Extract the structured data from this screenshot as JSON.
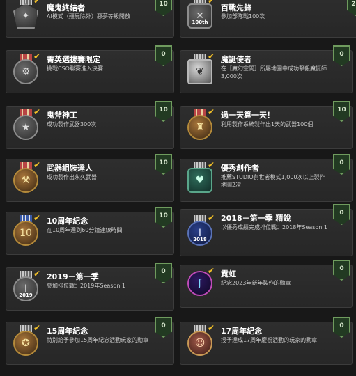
{
  "achievements": [
    {
      "title": "魔鬼終結者",
      "desc": "AI模式（殭屍除外）惡夢等級開啟",
      "points": "10",
      "icon": "shield-emblem-icon"
    },
    {
      "title": "百戰先鋒",
      "desc": "參加部隊戰100次",
      "points": "20",
      "icon": "crossed-rifles-100-icon",
      "medal_text": "100th"
    },
    {
      "title": "菁英選拔賽限定",
      "desc": "挑戰CSO聯賽進入決賽",
      "points": "0",
      "icon": "gear-medal-icon"
    },
    {
      "title": "魔誕使者",
      "desc": "在［魔幻空間］所屬地圖中成功擊殺魔誕師3,000次",
      "points": "0",
      "icon": "eagle-emblem-icon"
    },
    {
      "title": "鬼斧神工",
      "desc": "成功製作武器300次",
      "points": "10",
      "icon": "star-medal-icon"
    },
    {
      "title": "過一天算一天！",
      "desc": "利用製作系統製作出1天的武器100個",
      "points": "10",
      "icon": "backpack-medal-icon"
    },
    {
      "title": "武器組裝達人",
      "desc": "成功製作出永久武器",
      "points": "10",
      "icon": "wrench-medal-icon"
    },
    {
      "title": "優秀創作者",
      "desc": "推薦STUDIO創世者模式1,000次以上製作地圖2次",
      "points": "0",
      "icon": "heart-card-icon"
    },
    {
      "title": "10周年紀念",
      "desc": "在10周年達到60分鐘連線時間",
      "points": "10",
      "icon": "gold-10th-medal-icon",
      "medal_text": "10"
    },
    {
      "title": "2018－第一季 精銳",
      "desc": "以優秀成績完成排位戰：2018年Season 1",
      "points": "0",
      "icon": "season-2018-elite-icon",
      "medal_text": "2018"
    },
    {
      "title": "2019－第一季",
      "desc": "參加排位戰：2019年Season 1",
      "points": "0",
      "icon": "season-2019-icon",
      "medal_text": "2019"
    },
    {
      "title": "霓虹",
      "desc": "紀念2023年新年製作的勳章",
      "points": "0",
      "icon": "neon-medal-icon"
    },
    {
      "title": "15周年紀念",
      "desc": "特別給予參加15周年紀念活動玩家的勳章",
      "points": "0",
      "icon": "15th-medal-icon"
    },
    {
      "title": "17周年紀念",
      "desc": "授予達成17周年慶祝活動的玩家的勳章",
      "points": "0",
      "icon": "17th-portrait-medal-icon"
    }
  ],
  "check_mark": "✔"
}
